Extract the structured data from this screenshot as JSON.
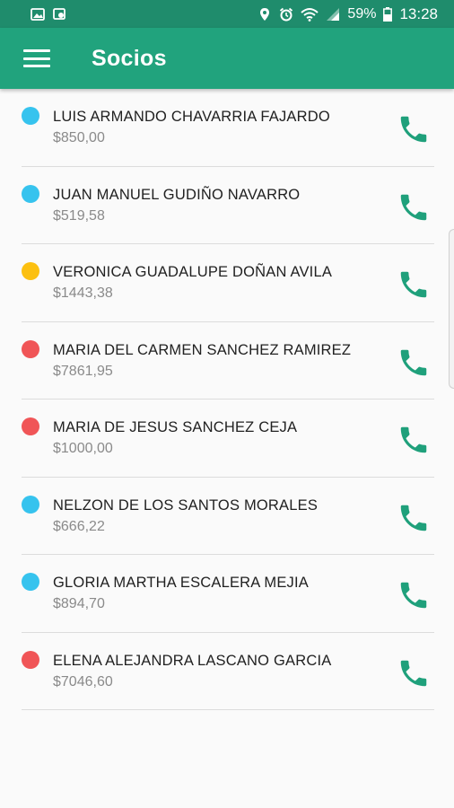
{
  "status_bar": {
    "battery": "59%",
    "time": "13:28",
    "icons": [
      "image-icon",
      "cast-icon",
      "location-icon",
      "alarm-icon",
      "wifi-icon",
      "signal-icon",
      "battery-icon"
    ]
  },
  "app_bar": {
    "title": "Socios",
    "menu_icon": "hamburger-menu-icon"
  },
  "colors": {
    "app_bar": "#21a37d",
    "status_bar": "#1f8c6c",
    "phone_icon": "#1fa07b"
  },
  "members": [
    {
      "name": "LUIS ARMANDO CHAVARRIA FAJARDO",
      "amount": "$850,00",
      "status_color": "#36c3ee"
    },
    {
      "name": "JUAN MANUEL GUDIÑO NAVARRO",
      "amount": "$519,58",
      "status_color": "#36c3ee"
    },
    {
      "name": "VERONICA GUADALUPE DOÑAN AVILA",
      "amount": "$1443,38",
      "status_color": "#fcc010"
    },
    {
      "name": "MARIA DEL CARMEN SANCHEZ RAMIREZ",
      "amount": "$7861,95",
      "status_color": "#f05557"
    },
    {
      "name": "MARIA DE JESUS SANCHEZ CEJA",
      "amount": "$1000,00",
      "status_color": "#f05557"
    },
    {
      "name": "NELZON DE LOS SANTOS MORALES",
      "amount": "$666,22",
      "status_color": "#36c3ee"
    },
    {
      "name": "GLORIA MARTHA ESCALERA MEJIA",
      "amount": "$894,70",
      "status_color": "#36c3ee"
    },
    {
      "name": "ELENA ALEJANDRA LASCANO GARCIA",
      "amount": "$7046,60",
      "status_color": "#f05557"
    }
  ]
}
